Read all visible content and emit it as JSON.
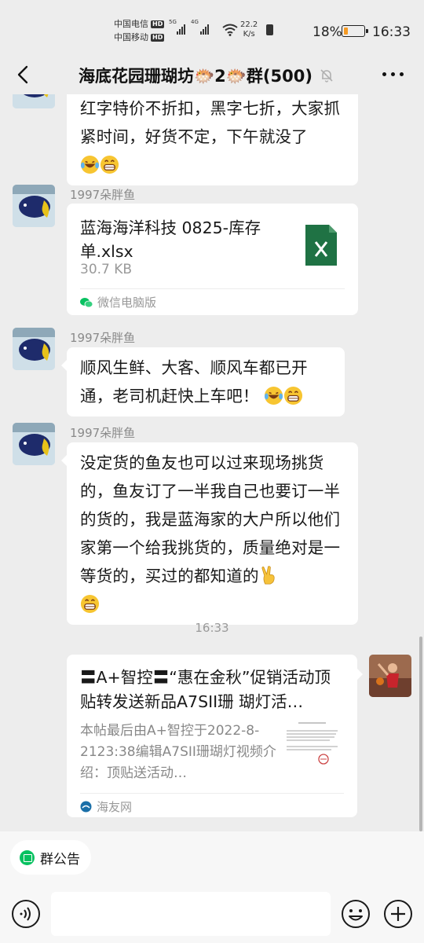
{
  "status_bar": {
    "carrier1": "中国电信",
    "carrier2": "中国移动",
    "hd": "HD",
    "sig1_label": "5G",
    "sig2_label": "4G",
    "net_speed_value": "22.2",
    "net_speed_unit": "K/s",
    "battery_percent": "18%",
    "battery_level": 0.18,
    "time": "16:33",
    "battery_color": "#f59a23"
  },
  "header": {
    "title": "海底花园珊瑚坊🐡2🐡群(500)",
    "back_icon": "chevron-left-icon",
    "mute_icon": "bell-off-icon",
    "more_icon": "more-dots-icon"
  },
  "messages": [
    {
      "type": "text",
      "sender": "",
      "text": "红字特价不折扣，黑字七折，大家抓紧时间，好货不定，下午就没了",
      "emojis": [
        "laugh-cry-emoji",
        "grin-emoji"
      ]
    },
    {
      "type": "file",
      "sender": "1997朵胖鱼",
      "file_name": "蓝海海洋科技 0825-库存单.xlsx",
      "file_size": "30.7 KB",
      "source": "微信电脑版"
    },
    {
      "type": "text",
      "sender": "1997朵胖鱼",
      "text": "顺风生鲜、大客、顺风车都已开通，老司机赶快上车吧！",
      "emojis": [
        "laugh-cry-emoji",
        "grin-emoji"
      ]
    },
    {
      "type": "text",
      "sender": "1997朵胖鱼",
      "text": "没定货的鱼友也可以过来现场挑货的，鱼友订了一半我自己也要订一半的货的，我是蓝海家的大户所以他们家第一个给我挑货的，质量绝对是一等货的，买过的都知道的",
      "emojis": [
        "victory-hand-emoji",
        "grin-emoji"
      ]
    }
  ],
  "timestamp": "16:33",
  "link_message": {
    "title": "〓A+智控〓“惠在金秋”促销活动顶贴转发送新品A7SII珊 瑚灯活…",
    "description": "本帖最后由A+智控于2022-8-2123:38编辑A7SII珊瑚灯视频介绍：顶贴送活动…",
    "source": "海友网"
  },
  "bottom": {
    "notice_label": "群公告",
    "input_value": "",
    "voice_icon": "voice-icon",
    "emoji_icon": "emoji-face-icon",
    "plus_icon": "plus-icon"
  },
  "colors": {
    "background": "#ededed",
    "bubble": "#ffffff",
    "wechat_green": "#07c160",
    "excel_green": "#1f7244"
  }
}
